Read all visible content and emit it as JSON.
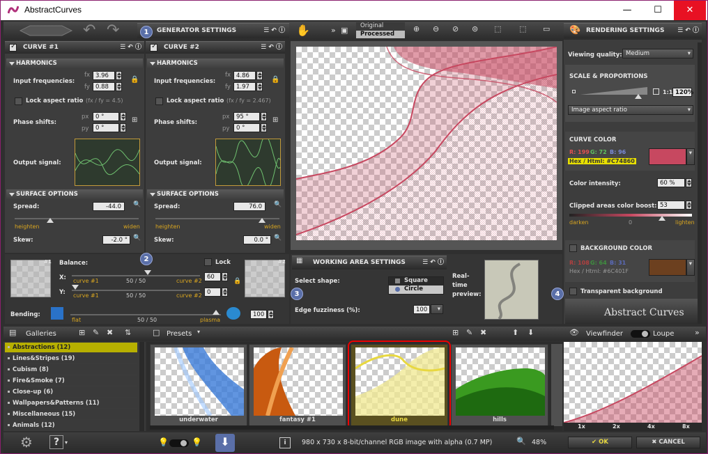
{
  "app": {
    "title": "AbstractCurves",
    "minimize": "—",
    "maximize": "☐",
    "close": "✕"
  },
  "toolbar": {
    "view_original": "Original",
    "view_processed": "Processed"
  },
  "generator": {
    "title": "GENERATOR SETTINGS",
    "badge": "1"
  },
  "curve1": {
    "title": "CURVE #1",
    "harmonics": "HARMONICS",
    "input_freq": "Input frequencies:",
    "fx": "3.96",
    "fy": "0.88",
    "lock_aspect": "Lock aspect ratio",
    "ratio": "(fx / fy = 4.5)",
    "phase": "Phase shifts:",
    "px": "0 °",
    "py": "0 °",
    "output": "Output signal:",
    "surface": "SURFACE OPTIONS",
    "spread_lbl": "Spread:",
    "spread": "-44.0",
    "heighten": "heighten",
    "widen": "widen",
    "skew_lbl": "Skew:",
    "skew": "-2.0 °",
    "sub_fx": "fx",
    "sub_fy": "fy",
    "sub_px": "px",
    "sub_py": "py"
  },
  "curve2": {
    "title": "CURVE #2",
    "harmonics": "HARMONICS",
    "input_freq": "Input frequencies:",
    "fx": "4.86",
    "fy": "1.97",
    "lock_aspect": "Lock aspect ratio",
    "ratio": "(fx / fy = 2.467)",
    "phase": "Phase shifts:",
    "px": "95 °",
    "py": "0 °",
    "output": "Output signal:",
    "surface": "SURFACE OPTIONS",
    "spread_lbl": "Spread:",
    "spread": "76.0",
    "heighten": "heighten",
    "widen": "widen",
    "skew_lbl": "Skew:",
    "skew": "0.0 °",
    "sub_fx": "fx",
    "sub_fy": "fy",
    "sub_px": "px",
    "sub_py": "py"
  },
  "balance": {
    "label": "Balance:",
    "badge": "2",
    "x_lbl": "X:",
    "y_lbl": "Y:",
    "x_left": "curve #1",
    "x_mid": "50 / 50",
    "x_right": "curve #2",
    "y_left": "curve #1",
    "y_mid": "50 / 50",
    "y_right": "curve #2",
    "lock": "Lock",
    "x_val": "60",
    "y_val": "0",
    "thumb1": "#1",
    "thumb2": "#2",
    "bending": "Bending:",
    "bend_left": "flat",
    "bend_mid": "50 / 50",
    "bend_right": "plasma",
    "bend_val": "100"
  },
  "working": {
    "title": "WORKING AREA SETTINGS",
    "badge": "3",
    "shape": "Select shape:",
    "square": "Square",
    "circle": "Circle",
    "fuzz": "Edge fuzziness (%):",
    "fuzz_val": "100",
    "preview": "Real-time preview:"
  },
  "rendering": {
    "title": "RENDERING SETTINGS",
    "badge": "4",
    "quality_lbl": "Viewing quality:",
    "quality": "Medium",
    "scale_title": "SCALE & PROPORTIONS",
    "ratio_1": "1:1",
    "zoom": "120%",
    "aspect": "Image aspect ratio",
    "curve_color": "CURVE COLOR",
    "r": "R: 199",
    "g": "G: 72",
    "b": "B: 96",
    "hex": "Hex / Html: #C74860",
    "color": "#C74860",
    "intensity_lbl": "Color intensity:",
    "intensity": "60 %",
    "boost_lbl": "Clipped areas color boost:",
    "boost": "53",
    "darken": "darken",
    "zero": "0",
    "lighten": "lighten",
    "bg_title": "BACKGROUND COLOR",
    "bg_r": "R: 108",
    "bg_g": "G: 64",
    "bg_b": "B: 31",
    "bg_hex": "Hex / Html: #6C401F",
    "bg_color": "#6C401F",
    "transparent": "Transparent background",
    "logo": "Abstract Curves"
  },
  "galleries": {
    "title": "Galleries",
    "items": [
      "Abstractions (12)",
      "Lines&Stripes (19)",
      "Cubism (8)",
      "Fire&Smoke (7)",
      "Close-up (6)",
      "Wallpapers&Patterns (11)",
      "Miscellaneous (15)",
      "Animals (12)"
    ]
  },
  "presets": {
    "title": "Presets",
    "items": [
      "underwater",
      "fantasy #1",
      "dune",
      "hills"
    ]
  },
  "viewfinder": {
    "title": "Viewfinder",
    "loupe": "Loupe",
    "zooms": [
      "1x",
      "2x",
      "4x",
      "8x"
    ]
  },
  "status": {
    "info": "980 x 730 x 8-bit/channel RGB image with alpha  (0.7 MP)",
    "zoom": "48%",
    "ok": "OK",
    "cancel": "CANCEL"
  }
}
